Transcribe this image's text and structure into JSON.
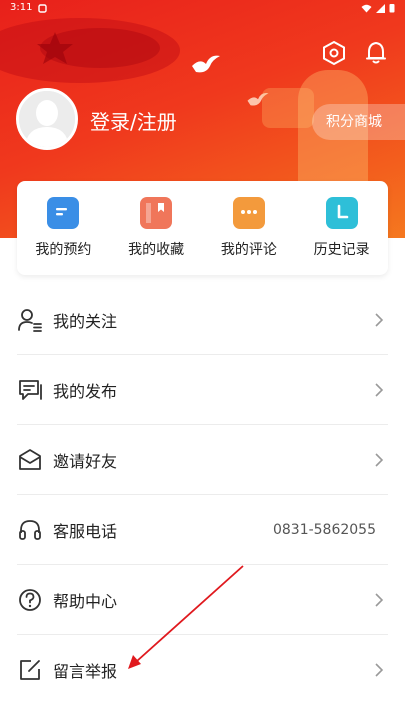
{
  "status_bar": {
    "time": "3:11"
  },
  "header": {
    "login_label": "登录/注册",
    "points_mall_label": "积分商城"
  },
  "quick_actions": [
    {
      "label": "我的预约",
      "icon": "reservation-icon",
      "color": "#3a8ee6"
    },
    {
      "label": "我的收藏",
      "icon": "favorites-icon",
      "color": "#f0765a"
    },
    {
      "label": "我的评论",
      "icon": "comment-icon",
      "color": "#f39a3c"
    },
    {
      "label": "历史记录",
      "icon": "history-icon",
      "color": "#2ebfd8"
    }
  ],
  "menu": [
    {
      "label": "我的关注",
      "icon": "user-follow-icon",
      "value": ""
    },
    {
      "label": "我的发布",
      "icon": "publish-chat-icon",
      "value": ""
    },
    {
      "label": "邀请好友",
      "icon": "invite-mail-icon",
      "value": ""
    },
    {
      "label": "客服电话",
      "icon": "headset-icon",
      "value": "0831-5862055"
    },
    {
      "label": "帮助中心",
      "icon": "help-icon",
      "value": ""
    },
    {
      "label": "留言举报",
      "icon": "edit-report-icon",
      "value": ""
    }
  ],
  "colors": {
    "brand_red": "#e8201b",
    "brand_orange": "#f5781f",
    "annotation_arrow": "#e0191e"
  }
}
